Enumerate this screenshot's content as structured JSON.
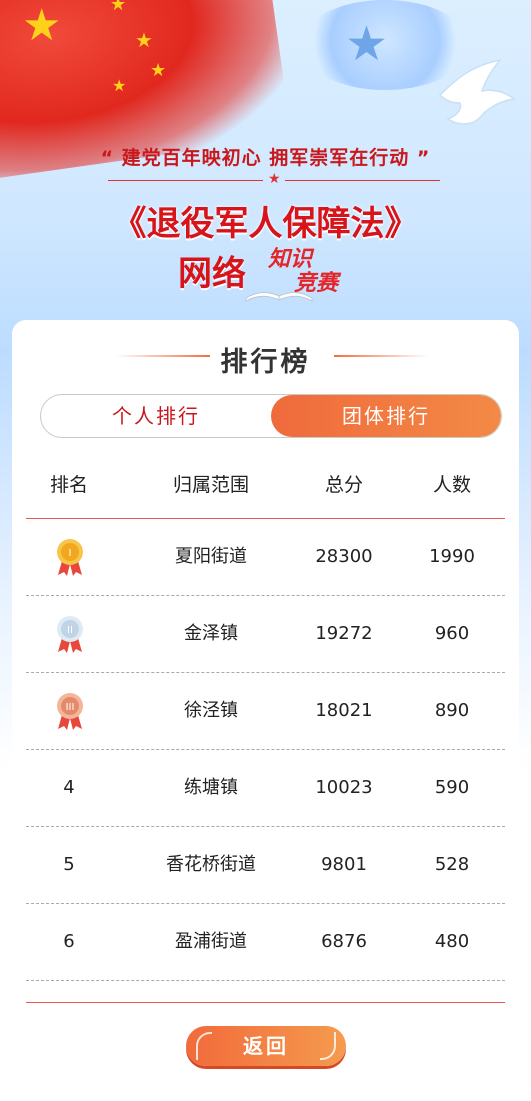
{
  "banner": {
    "slogan": "“ 建党百年映初心  拥军崇军在行动 ”",
    "law_title": "《退役军人保障法》",
    "subtitle_net": "网络",
    "subtitle_quiz_1": "知识",
    "subtitle_quiz_2": "竞赛"
  },
  "card": {
    "title": "排行榜"
  },
  "tabs": {
    "personal": "个人排行",
    "group": "团体排行",
    "active": "group"
  },
  "table": {
    "headers": [
      "排名",
      "归属范围",
      "总分",
      "人数"
    ],
    "rows": [
      {
        "rank": "",
        "medal": "gold-medal-icon",
        "area": "夏阳街道",
        "score": "28300",
        "count": "1990"
      },
      {
        "rank": "",
        "medal": "silver-medal-icon",
        "area": "金泽镇",
        "score": "19272",
        "count": "960"
      },
      {
        "rank": "",
        "medal": "bronze-medal-icon",
        "area": "徐泾镇",
        "score": "18021",
        "count": "890"
      },
      {
        "rank": "4",
        "medal": "",
        "area": "练塘镇",
        "score": "10023",
        "count": "590"
      },
      {
        "rank": "5",
        "medal": "",
        "area": "香花桥街道",
        "score": "9801",
        "count": "528"
      },
      {
        "rank": "6",
        "medal": "",
        "area": "盈浦街道",
        "score": "6876",
        "count": "480"
      }
    ]
  },
  "footer": {
    "back_label": "返回"
  },
  "colors": {
    "accent_red": "#d7141a",
    "accent_orange": "#f06a3c",
    "medal_gold": "#f2a81e",
    "medal_silver": "#bfd4e6",
    "medal_bronze": "#e48a6a"
  }
}
